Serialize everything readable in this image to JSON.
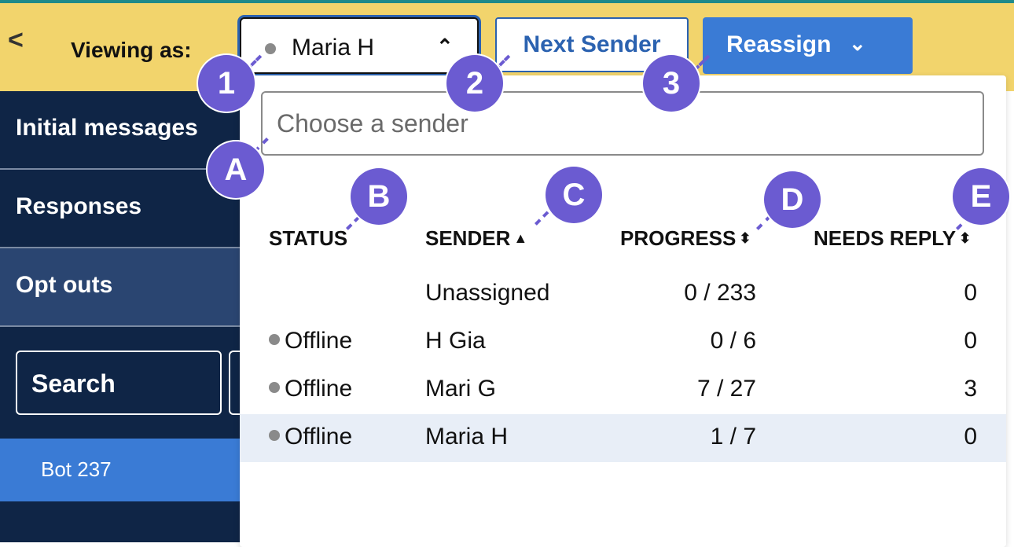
{
  "header": {
    "back_icon": "chevron-left-icon",
    "viewing_label": "Viewing as:",
    "selected_sender": "Maria H",
    "next_button": "Next Sender",
    "reassign_button": "Reassign"
  },
  "sidebar": {
    "items": [
      {
        "label": "Initial messages"
      },
      {
        "label": "Responses"
      },
      {
        "label": "Opt outs"
      }
    ],
    "search_label": "Search",
    "bot_label": "Bot 237"
  },
  "dropdown": {
    "placeholder": "Choose a sender",
    "columns": [
      "STATUS",
      "SENDER",
      "PROGRESS",
      "NEEDS REPLY"
    ],
    "rows": [
      {
        "status": "",
        "sender": "Unassigned",
        "progress": "0 / 233",
        "needs_reply": "0"
      },
      {
        "status": "Offline",
        "sender": "H Gia",
        "progress": "0 / 6",
        "needs_reply": "0"
      },
      {
        "status": "Offline",
        "sender": "Mari G",
        "progress": "7 / 27",
        "needs_reply": "3"
      },
      {
        "status": "Offline",
        "sender": "Maria H",
        "progress": "1 / 7",
        "needs_reply": "0"
      }
    ]
  },
  "markers": [
    "1",
    "2",
    "3",
    "A",
    "B",
    "C",
    "D",
    "E"
  ],
  "colors": {
    "topbar": "#f2d46c",
    "sidebar": "#0f2546",
    "accent": "#3a7bd5",
    "marker": "#6b5bd1",
    "status_offline": "#8a8a8a"
  }
}
